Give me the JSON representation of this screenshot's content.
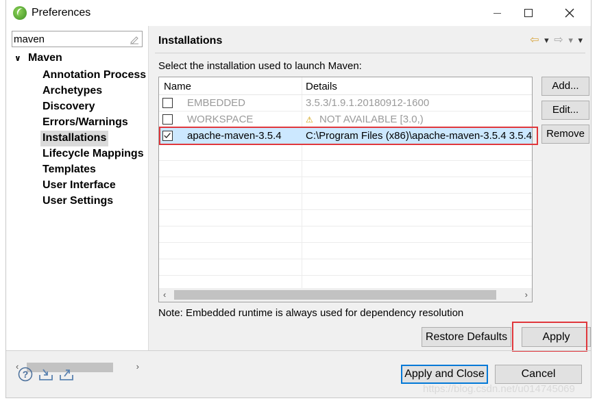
{
  "window": {
    "title": "Preferences"
  },
  "sidebar": {
    "filter_value": "maven",
    "root_label": "Maven",
    "items": [
      {
        "label": "Annotation Process"
      },
      {
        "label": "Archetypes"
      },
      {
        "label": "Discovery"
      },
      {
        "label": "Errors/Warnings"
      },
      {
        "label": "Installations"
      },
      {
        "label": "Lifecycle Mappings"
      },
      {
        "label": "Templates"
      },
      {
        "label": "User Interface"
      },
      {
        "label": "User Settings"
      }
    ],
    "selected_item": "Installations"
  },
  "main": {
    "title": "Installations",
    "prompt": "Select the installation used to launch Maven:",
    "table": {
      "headers": {
        "name": "Name",
        "details": "Details"
      },
      "rows": [
        {
          "checked": false,
          "name": "EMBEDDED",
          "details": "3.5.3/1.9.1.20180912-1600",
          "dimmed": true
        },
        {
          "checked": false,
          "name": "WORKSPACE",
          "details": "NOT AVAILABLE [3.0,)",
          "dimmed": true,
          "warning": true
        },
        {
          "checked": true,
          "name": "apache-maven-3.5.4",
          "details": "C:\\Program Files (x86)\\apache-maven-3.5.4 3.5.4",
          "dimmed": false
        }
      ]
    },
    "buttons": {
      "add": "Add...",
      "edit": "Edit...",
      "remove": "Remove"
    },
    "note": "Note: Embedded runtime is always used for dependency resolution",
    "restore_defaults": "Restore Defaults",
    "apply": "Apply"
  },
  "footer": {
    "apply_and_close": "Apply and Close",
    "cancel": "Cancel",
    "watermark": "https://blog.csdn.net/u014745069"
  },
  "colors": {
    "highlight": "#e0363b",
    "selection": "#cce8ff",
    "default_button_border": "#0078d7"
  }
}
